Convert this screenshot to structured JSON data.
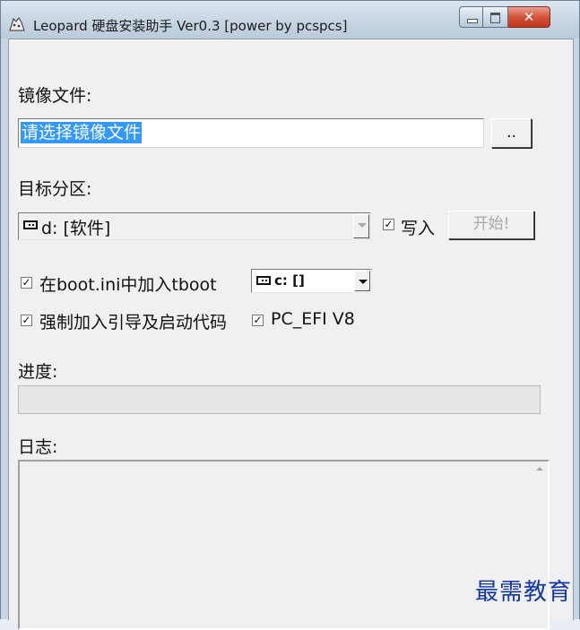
{
  "window": {
    "title": "Leopard 硬盘安装助手 Ver0.3 [power by pcspcs]",
    "icon": "app-icon"
  },
  "image_file": {
    "label": "镜像文件:",
    "value": "请选择镜像文件",
    "browse_label": ".."
  },
  "target_partition": {
    "label": "目标分区:",
    "selected": "d: [软件]",
    "write_checked": true,
    "write_label": "写入",
    "start_label": "开始!"
  },
  "options": {
    "bootini_checked": true,
    "bootini_label": "在boot.ini中加入tboot",
    "bootini_drive": "c: []",
    "force_checked": true,
    "force_label": "强制加入引导及启动代码",
    "pcefi_checked": true,
    "pcefi_label": "PC_EFI V8"
  },
  "progress": {
    "label": "进度:",
    "percent": 0
  },
  "log": {
    "label": "日志:",
    "content": ""
  },
  "watermark": "最需教育",
  "colors": {
    "selection": "#3399ff",
    "close_button": "#c2381f",
    "watermark": "#1437a8"
  }
}
